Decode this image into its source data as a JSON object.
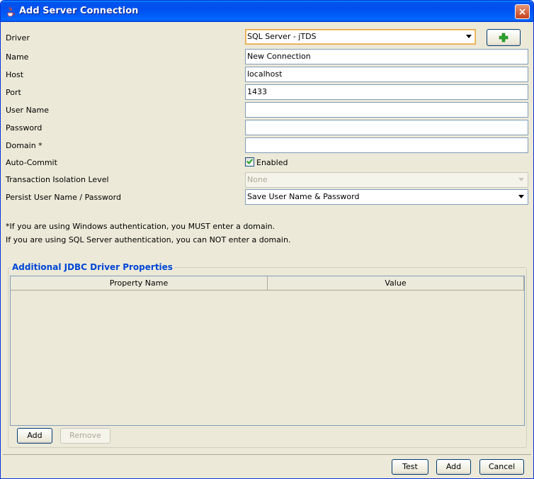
{
  "window": {
    "title": "Add Server Connection",
    "close_label": "×"
  },
  "form": {
    "driver_label": "Driver",
    "driver_value": "SQL Server - jTDS",
    "name_label": "Name",
    "name_value": "New Connection",
    "host_label": "Host",
    "host_value": "localhost",
    "port_label": "Port",
    "port_value": "1433",
    "username_label": "User Name",
    "username_value": "",
    "password_label": "Password",
    "password_value": "",
    "domain_label": "Domain *",
    "domain_value": "",
    "autocommit_label": "Auto-Commit",
    "autocommit_checkbox_label": "Enabled",
    "autocommit_checked": true,
    "isolation_label": "Transaction Isolation Level",
    "isolation_value": "None",
    "persist_label": "Persist User Name / Password",
    "persist_value": "Save User Name & Password"
  },
  "notes": {
    "line1": "*If you are using Windows authentication, you MUST enter a domain.",
    "line2": "If you are using SQL Server authentication, you can NOT enter a domain."
  },
  "jdbc": {
    "group_title": "Additional JDBC Driver Properties",
    "columns": [
      "Property Name",
      "Value"
    ],
    "rows": [],
    "add_label": "Add",
    "remove_label": "Remove"
  },
  "footer": {
    "test_label": "Test",
    "add_label": "Add",
    "cancel_label": "Cancel"
  },
  "colors": {
    "titlebar": "#0054e3",
    "dialog_bg": "#ece9d8",
    "group_title": "#0046d5",
    "add_icon": "#2ea52e"
  }
}
